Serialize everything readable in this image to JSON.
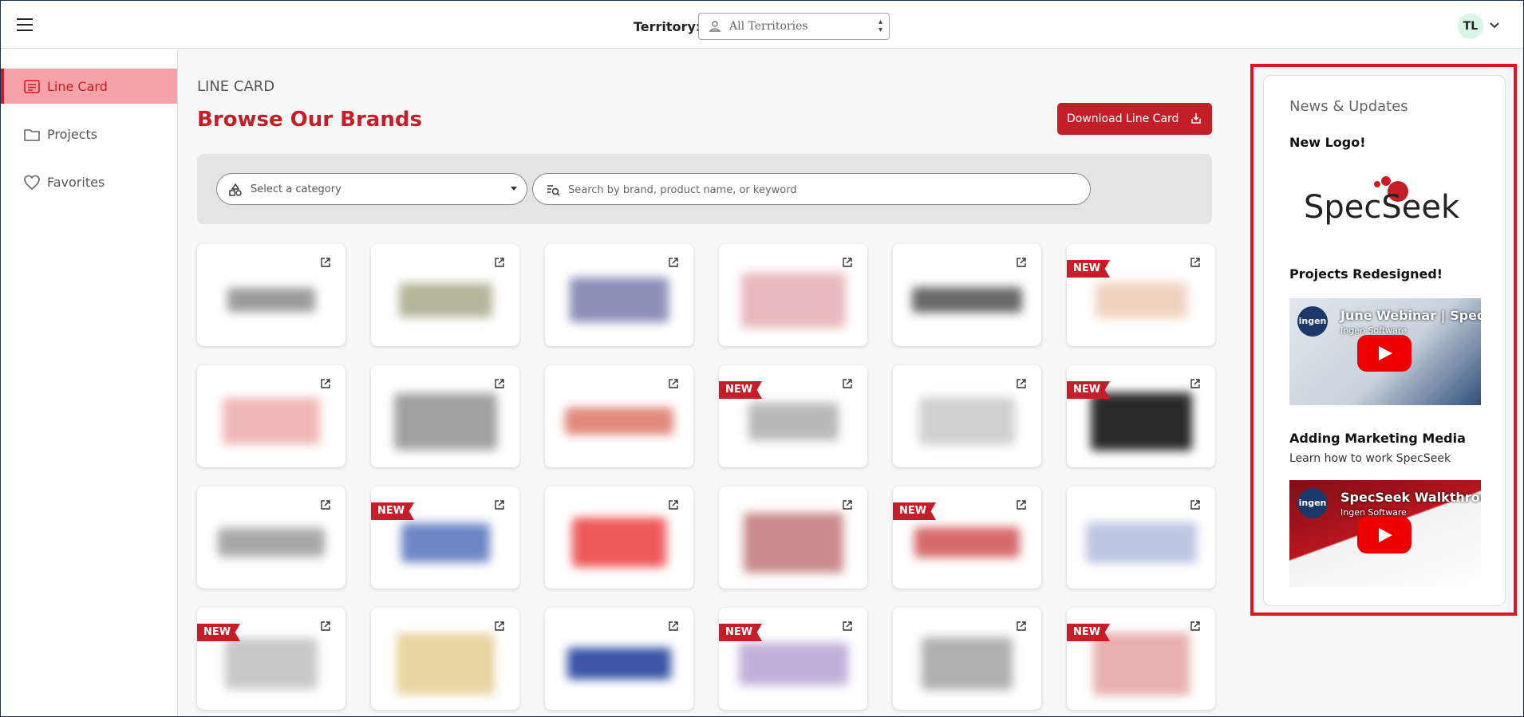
{
  "header": {
    "territory_label": "Territory:",
    "territory_value": "All Territories",
    "user_initials": "TL"
  },
  "sidebar": {
    "items": [
      {
        "label": "Line Card",
        "icon": "list-icon",
        "active": true
      },
      {
        "label": "Projects",
        "icon": "folder-icon",
        "active": false
      },
      {
        "label": "Favorites",
        "icon": "heart-icon",
        "active": false
      }
    ]
  },
  "main": {
    "kicker": "LINE CARD",
    "title": "Browse Our Brands",
    "download_label": "Download Line Card",
    "category_placeholder": "Select a category",
    "search_placeholder": "Search by brand, product name, or keyword",
    "new_badge": "NEW",
    "brand_cards": [
      {
        "new": false,
        "logo_color": "#9a9a9a"
      },
      {
        "new": false,
        "logo_color": "#b5b59a"
      },
      {
        "new": false,
        "logo_color": "#8c8fb8"
      },
      {
        "new": false,
        "logo_color": "#e8b9bc"
      },
      {
        "new": false,
        "logo_color": "#6a6a6a"
      },
      {
        "new": true,
        "logo_color": "#f0d2bf"
      },
      {
        "new": false,
        "logo_color": "#f0b6b6"
      },
      {
        "new": false,
        "logo_color": "#a0a0a0"
      },
      {
        "new": false,
        "logo_color": "#e08a7a"
      },
      {
        "new": true,
        "logo_color": "#b8b8b8"
      },
      {
        "new": false,
        "logo_color": "#d0d0d0"
      },
      {
        "new": true,
        "logo_color": "#2a2a2a"
      },
      {
        "new": false,
        "logo_color": "#a8a8a8"
      },
      {
        "new": true,
        "logo_color": "#6d86c4"
      },
      {
        "new": false,
        "logo_color": "#ee5a5a"
      },
      {
        "new": false,
        "logo_color": "#c98a8a"
      },
      {
        "new": true,
        "logo_color": "#d86a6a"
      },
      {
        "new": false,
        "logo_color": "#bcc6e0"
      },
      {
        "new": true,
        "logo_color": "#c8c8c8"
      },
      {
        "new": false,
        "logo_color": "#e8d4a0"
      },
      {
        "new": false,
        "logo_color": "#3b56a8"
      },
      {
        "new": true,
        "logo_color": "#c0b0d8"
      },
      {
        "new": false,
        "logo_color": "#b0b0b0"
      },
      {
        "new": true,
        "logo_color": "#e8b0b0"
      }
    ]
  },
  "news": {
    "title": "News & Updates",
    "items": [
      {
        "heading": "New Logo!",
        "logo_text": "SpecSeek"
      },
      {
        "heading": "Projects Redesigned!",
        "video_title": "June Webinar | SpecSeek",
        "video_channel": "Ingen Software",
        "channel_badge": "ingen"
      },
      {
        "heading": "Adding Marketing Media",
        "subtitle": "Learn how to work SpecSeek",
        "video_title": "SpecSeek Walkthrough",
        "video_channel": "Ingen Software",
        "channel_badge": "ingen"
      }
    ]
  },
  "colors": {
    "brand_red": "#c41e28",
    "sidebar_active_bg": "#f6a3a8",
    "highlight_frame": "#e0141e"
  }
}
